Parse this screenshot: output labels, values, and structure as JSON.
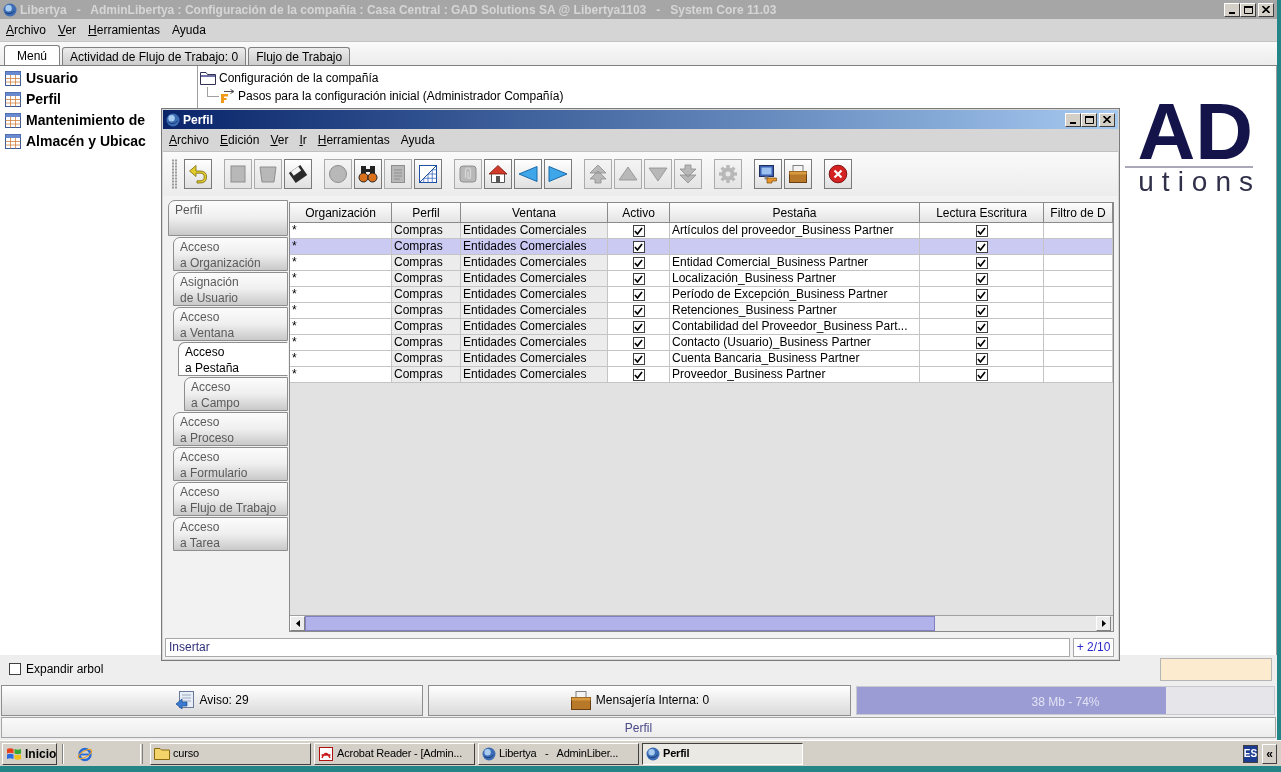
{
  "window": {
    "title": "Libertya   -   AdminLibertya : Configuración de la compañía : Casa Central : GAD Solutions SA @ Libertya1103   -   System Core 11.03"
  },
  "menu": [
    {
      "label": "Archivo",
      "mnemonic": true
    },
    {
      "label": "Ver",
      "mnemonic": true
    },
    {
      "label": "Herramientas",
      "mnemonic": true
    },
    {
      "label": "Ayuda",
      "mnemonic": false
    }
  ],
  "tabs": [
    {
      "label": "Menú",
      "selected": true
    },
    {
      "label": "Actividad de Flujo de Trabajo: 0",
      "selected": false
    },
    {
      "label": "Flujo de Trabajo",
      "selected": false
    }
  ],
  "favorites": [
    "Usuario",
    "Perfil",
    "Mantenimiento de",
    "Almacén y Ubicac"
  ],
  "tree": [
    {
      "label": "Configuración de la compañía",
      "kind": "folder",
      "children": [
        {
          "label": "Pasos para la configuración inicial (Administrador Compañía)",
          "kind": "workflow"
        }
      ]
    }
  ],
  "logo": {
    "mark": "AD",
    "tagline": "utions"
  },
  "expand_tree": {
    "label": "Expandir arbol",
    "checked": false
  },
  "notice_button": {
    "label": "Aviso: 29"
  },
  "messages_button": {
    "label": "Mensajería Interna: 0"
  },
  "memory": {
    "reading": "38 Mb - 74%",
    "level": 0.74
  },
  "status_line": "Perfil",
  "child_window": {
    "title": "Perfil",
    "menu": [
      {
        "label": "Archivo",
        "mnemonic": true
      },
      {
        "label": "Edición",
        "mnemonic": true
      },
      {
        "label": "Ver",
        "mnemonic": true
      },
      {
        "label": "Ir",
        "mnemonic": true
      },
      {
        "label": "Herramientas",
        "mnemonic": true
      },
      {
        "label": "Ayuda",
        "mnemonic": false
      }
    ],
    "toolbar": [
      [
        {
          "disabled": false
        }
      ],
      [
        {
          "disabled": true
        },
        {
          "disabled": true
        },
        {
          "disabled": false
        }
      ],
      [
        {
          "disabled": true
        },
        {
          "disabled": false
        },
        {
          "disabled": true
        },
        {
          "disabled": false
        }
      ],
      [
        {
          "disabled": true
        },
        {
          "disabled": false
        },
        {
          "disabled": false
        },
        {
          "disabled": false
        }
      ],
      [
        {
          "disabled": true
        },
        {
          "disabled": true
        },
        {
          "disabled": true
        },
        {
          "disabled": true
        }
      ],
      [
        {
          "disabled": true
        }
      ],
      [
        {
          "disabled": false
        },
        {
          "disabled": false
        }
      ],
      [
        {
          "disabled": false
        }
      ]
    ],
    "tabs": [
      {
        "label": "Perfil",
        "selected": false,
        "children": [
          {
            "label": "Acceso\na Organización",
            "selected": false
          },
          {
            "label": "Asignación\nde Usuario",
            "selected": false
          },
          {
            "label": "Acceso\na Ventana",
            "selected": false,
            "children": [
              {
                "label": "Acceso\na Pestaña",
                "selected": true,
                "children": [
                  {
                    "label": "Acceso\na Campo",
                    "selected": false
                  }
                ]
              }
            ]
          },
          {
            "label": "Acceso\na Proceso",
            "selected": false
          },
          {
            "label": "Acceso\na Formulario",
            "selected": false
          },
          {
            "label": "Acceso\na Flujo de Trabajo",
            "selected": false
          },
          {
            "label": "Acceso\na Tarea",
            "selected": false
          }
        ]
      }
    ],
    "table": {
      "columns": [
        {
          "label": "Organización",
          "read_only": false
        },
        {
          "label": "Perfil",
          "read_only": true
        },
        {
          "label": "Ventana",
          "read_only": true
        },
        {
          "label": "Activo",
          "read_only": false
        },
        {
          "label": "Pestaña",
          "read_only": false
        },
        {
          "label": "Lectura Escritura",
          "read_only": false
        },
        {
          "label": "Filtro de D",
          "read_only": false
        }
      ],
      "rows": [
        {
          "selected": false,
          "organizacion": "*",
          "perfil": "Compras",
          "ventana": "Entidades Comerciales",
          "activo": true,
          "pestana": "Artículos del proveedor_Business Partner",
          "lectura_escritura": true
        },
        {
          "selected": true,
          "organizacion": "*",
          "perfil": "Compras",
          "ventana": "Entidades Comerciales",
          "activo": true,
          "lectura_escritura": true
        },
        {
          "selected": false,
          "organizacion": "*",
          "perfil": "Compras",
          "ventana": "Entidades Comerciales",
          "activo": true,
          "pestana": "Entidad Comercial_Business Partner",
          "lectura_escritura": true
        },
        {
          "selected": false,
          "organizacion": "*",
          "perfil": "Compras",
          "ventana": "Entidades Comerciales",
          "activo": true,
          "pestana": "Localización_Business Partner",
          "lectura_escritura": true
        },
        {
          "selected": false,
          "organizacion": "*",
          "perfil": "Compras",
          "ventana": "Entidades Comerciales",
          "activo": true,
          "pestana": "Período de Excepción_Business Partner",
          "lectura_escritura": true
        },
        {
          "selected": false,
          "organizacion": "*",
          "perfil": "Compras",
          "ventana": "Entidades Comerciales",
          "activo": true,
          "pestana": "Retenciones_Business Partner",
          "lectura_escritura": true
        },
        {
          "selected": false,
          "organizacion": "*",
          "perfil": "Compras",
          "ventana": "Entidades Comerciales",
          "activo": true,
          "pestana": "Contabilidad del Proveedor_Business Part...",
          "lectura_escritura": true
        },
        {
          "selected": false,
          "organizacion": "*",
          "perfil": "Compras",
          "ventana": "Entidades Comerciales",
          "activo": true,
          "pestana": "Contacto (Usuario)_Business Partner",
          "lectura_escritura": true
        },
        {
          "selected": false,
          "organizacion": "*",
          "perfil": "Compras",
          "ventana": "Entidades Comerciales",
          "activo": true,
          "pestana": "Cuenta Bancaria_Business Partner",
          "lectura_escritura": true
        },
        {
          "selected": false,
          "organizacion": "*",
          "perfil": "Compras",
          "ventana": "Entidades Comerciales",
          "activo": true,
          "pestana": "Proveedor_Business Partner",
          "lectura_escritura": true
        }
      ]
    },
    "status": {
      "message": "Insertar",
      "record": "+ 2/10"
    }
  },
  "taskbar": {
    "start": "Inicio",
    "tasks": [
      {
        "label": "curso",
        "kind": "folder",
        "selected": false
      },
      {
        "label": "Acrobat Reader - [Admin...",
        "kind": "document",
        "selected": false
      },
      {
        "label": "Libertya   -   AdminLiber...",
        "kind": "application",
        "selected": false
      },
      {
        "label": "Perfil",
        "kind": "application",
        "selected": true
      }
    ],
    "tray": {
      "language": "ES",
      "expand": "«"
    }
  }
}
